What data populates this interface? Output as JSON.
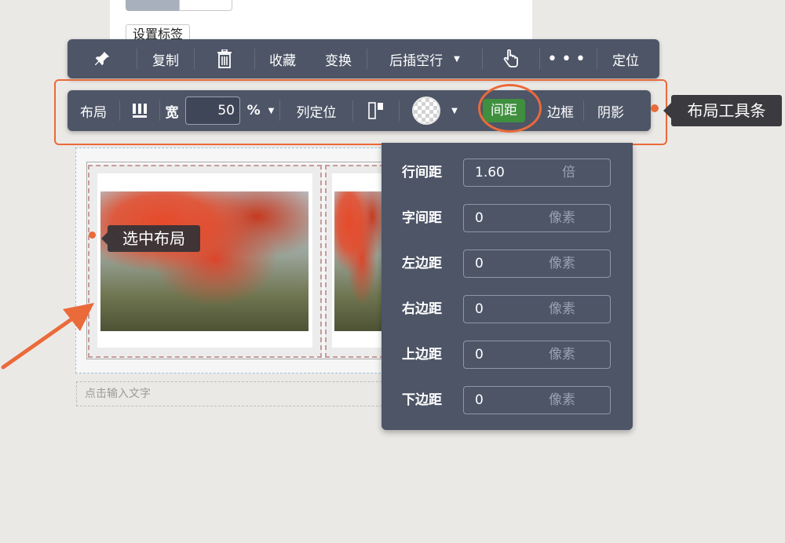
{
  "document": {
    "set_tag_label": "设置标签",
    "text_placeholder": "点击输入文字"
  },
  "main_toolbar": {
    "pin_icon": "pushpin-icon",
    "copy_label": "复制",
    "delete_icon": "trash-icon",
    "favorite_label": "收藏",
    "transform_label": "变换",
    "insert_after_label": "后插空行",
    "select_icon": "pointer-hand-icon",
    "more_label": "•••",
    "locate_label": "定位"
  },
  "layout_toolbar": {
    "layout_label": "布局",
    "columns_icon": "columns-icon",
    "width_label": "宽",
    "width_value": "50",
    "width_unit": "%",
    "column_position_label": "列定位",
    "align_icon": "align-top-icon",
    "spacing_label": "间距",
    "border_label": "边框",
    "shadow_label": "阴影",
    "accent_color": "#3f8f3f"
  },
  "annotations": {
    "toolbar_callout": "布局工具条",
    "select_layout_label": "选中布局",
    "highlight_color": "#ea6a3a"
  },
  "spacing_panel": {
    "rows": [
      {
        "label": "行间距",
        "value": "1.60",
        "unit": "倍"
      },
      {
        "label": "字间距",
        "value": "0",
        "unit": "像素"
      },
      {
        "label": "左边距",
        "value": "0",
        "unit": "像素"
      },
      {
        "label": "右边距",
        "value": "0",
        "unit": "像素"
      },
      {
        "label": "上边距",
        "value": "0",
        "unit": "像素"
      },
      {
        "label": "下边距",
        "value": "0",
        "unit": "像素"
      }
    ]
  }
}
